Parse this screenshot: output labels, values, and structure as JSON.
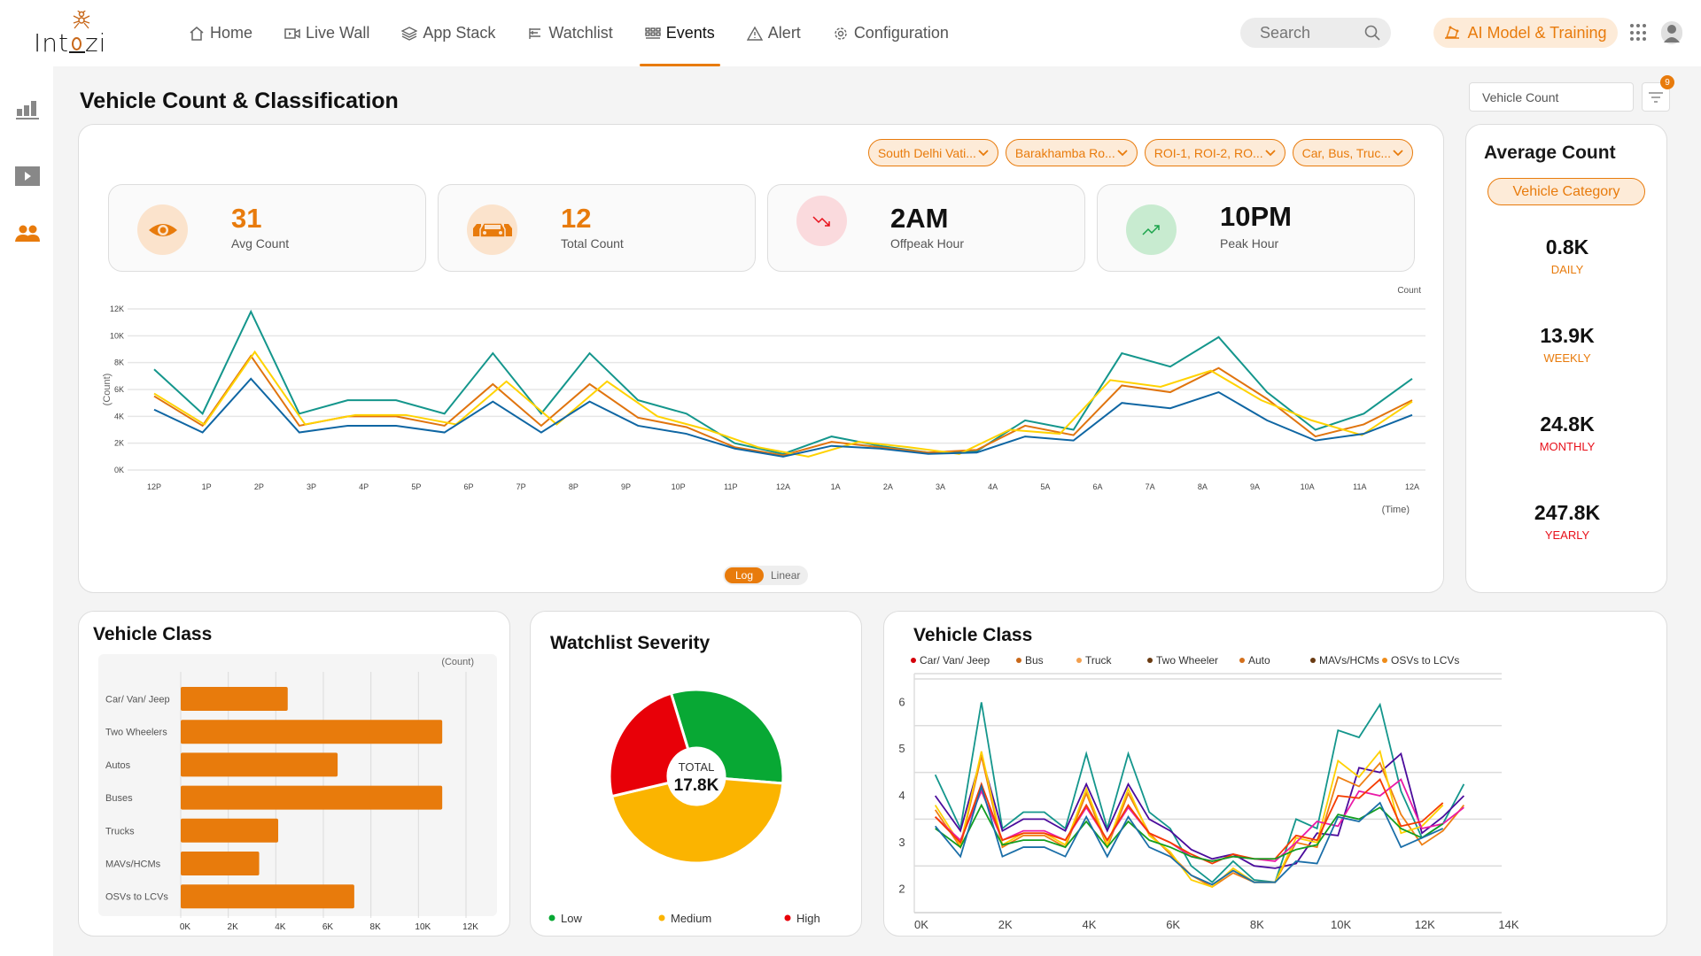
{
  "app": {
    "logo_text": "Int zi",
    "logo_prefix": "Int",
    "logo_suffix": "zi"
  },
  "nav": {
    "items": [
      {
        "label": "Home",
        "icon": "home-icon",
        "active": false
      },
      {
        "label": "Live Wall",
        "icon": "video-icon",
        "active": false
      },
      {
        "label": "App Stack",
        "icon": "layers-icon",
        "active": false
      },
      {
        "label": "Watchlist",
        "icon": "list-icon",
        "active": false
      },
      {
        "label": "Events",
        "icon": "grid-icon",
        "active": true
      },
      {
        "label": "Alert",
        "icon": "alert-icon",
        "active": false
      },
      {
        "label": "Configuration",
        "icon": "gear-icon",
        "active": false
      }
    ],
    "search_placeholder": "Search",
    "ai_button": "AI Model & Training"
  },
  "sidebar": {
    "items": [
      {
        "icon": "bar-chart-icon",
        "active": false
      },
      {
        "icon": "play-icon",
        "active": false
      },
      {
        "icon": "users-icon",
        "active": true
      }
    ]
  },
  "page": {
    "title": "Vehicle Count & Classification",
    "metric_select": "Vehicle Count",
    "filter_badge": "9"
  },
  "filters": [
    {
      "label": "South Delhi Vati..."
    },
    {
      "label": "Barakhamba Ro..."
    },
    {
      "label": "ROI-1, ROI-2, RO..."
    },
    {
      "label": "Car, Bus, Truc..."
    }
  ],
  "kpis": [
    {
      "value": "31",
      "label": "Avg Count",
      "icon": "eye-icon",
      "value_color": "#e87b0c",
      "bg": "#fbe3cc"
    },
    {
      "value": "12",
      "label": "Total Count",
      "icon": "cars-icon",
      "value_color": "#e87b0c",
      "bg": "#fbe3cc"
    },
    {
      "value": "2AM",
      "label": "Offpeak Hour",
      "icon": "trend-down-icon",
      "value_color": "#111111",
      "bg": "#fadadd"
    },
    {
      "value": "10PM",
      "label": "Peak Hour",
      "icon": "trend-up-icon",
      "value_color": "#111111",
      "bg": "#c8ebd0"
    }
  ],
  "scale_toggle": {
    "options": [
      "Log",
      "Linear"
    ],
    "selected": "Log"
  },
  "average_count": {
    "title": "Average Count",
    "category_button": "Vehicle Category",
    "items": [
      {
        "value": "0.8K",
        "label": "DAILY",
        "color": "#e87b0c"
      },
      {
        "value": "13.9K",
        "label": "WEEKLY",
        "color": "#e87b0c"
      },
      {
        "value": "24.8K",
        "label": "MONTHLY",
        "color": "#e8101a"
      },
      {
        "value": "247.8K",
        "label": "YEARLY",
        "color": "#e8101a"
      }
    ]
  },
  "chart_data": [
    {
      "id": "hourly-count",
      "type": "line",
      "title": "",
      "xlabel": "(Time)",
      "ylabel": "(Count)",
      "corner_label": "Count",
      "categories": [
        "12P",
        "1P",
        "2P",
        "3P",
        "4P",
        "5P",
        "6P",
        "7P",
        "8P",
        "9P",
        "10P",
        "11P",
        "12A",
        "1A",
        "2A",
        "3A",
        "4A",
        "5A",
        "6A",
        "7A",
        "8A",
        "9A",
        "10A",
        "11A",
        "12A"
      ],
      "yticks": [
        "0K",
        "2K",
        "4K",
        "6K",
        "8K",
        "10K",
        "12K"
      ],
      "ylim": [
        0,
        12000
      ],
      "grid": true,
      "series": [
        {
          "name": "series-teal",
          "color": "#14968c",
          "values": [
            7500,
            4200,
            11800,
            4200,
            5200,
            5200,
            4200,
            8700,
            4200,
            8700,
            5200,
            4200,
            2000,
            1200,
            2500,
            1800,
            1300,
            1400,
            3700,
            3000,
            8700,
            7700,
            9900,
            5800,
            3000,
            4200,
            6800
          ]
        },
        {
          "name": "series-orange",
          "color": "#e0740e",
          "values": [
            5500,
            3300,
            8500,
            3300,
            4000,
            4000,
            3300,
            6400,
            3300,
            6400,
            3900,
            3200,
            1700,
            1100,
            2100,
            1700,
            1300,
            1500,
            3300,
            2600,
            6300,
            5800,
            7600,
            5300,
            2500,
            3400,
            5200
          ]
        },
        {
          "name": "series-yellow",
          "color": "#ffd200",
          "values": [
            5700,
            3400,
            8800,
            3400,
            4100,
            4100,
            3400,
            6600,
            3400,
            6600,
            4000,
            3000,
            1700,
            1000,
            2100,
            1700,
            1200,
            3000,
            2700,
            6700,
            6200,
            7400,
            5200,
            3700,
            2600,
            5100
          ]
        },
        {
          "name": "series-blue",
          "color": "#0f66a3",
          "values": [
            4500,
            2800,
            6800,
            2800,
            3300,
            3300,
            2800,
            5100,
            2800,
            5100,
            3300,
            2700,
            1600,
            1000,
            1800,
            1600,
            1200,
            1300,
            2500,
            2200,
            5000,
            4600,
            5800,
            3700,
            2200,
            2700,
            4100
          ]
        }
      ]
    },
    {
      "id": "vehicle-class-bar",
      "type": "bar",
      "orientation": "horizontal",
      "title": "Vehicle Class",
      "xlabel": "(Count)",
      "categories": [
        "Car/ Van/ Jeep",
        "Two Wheelers",
        "Autos",
        "Buses",
        "Trucks",
        "MAVs/HCMs",
        "OSVs to LCVs"
      ],
      "values": [
        4500,
        11000,
        6600,
        11000,
        4100,
        3300,
        7300
      ],
      "xticks": [
        "0K",
        "2K",
        "4K",
        "6K",
        "8K",
        "10K",
        "12K"
      ],
      "xlim": [
        0,
        12000
      ],
      "color": "#e87b0c",
      "grid": true
    },
    {
      "id": "watchlist-severity",
      "type": "pie",
      "title": "Watchlist Severity",
      "center_label": "TOTAL",
      "center_value": "17.8K",
      "slices": [
        {
          "name": "Low",
          "value": 31,
          "color": "#08a834"
        },
        {
          "name": "Medium",
          "value": 45,
          "color": "#fbb400"
        },
        {
          "name": "High",
          "value": 24,
          "color": "#e80008"
        }
      ],
      "legend": "bottom"
    },
    {
      "id": "vehicle-class-lines",
      "type": "line",
      "title": "Vehicle Class",
      "legend": [
        {
          "name": "Car/ Van/ Jeep",
          "dot": "#d4000a"
        },
        {
          "name": "Bus",
          "dot": "#c8681a"
        },
        {
          "name": "Truck",
          "dot": "#f2a050"
        },
        {
          "name": "Two Wheeler",
          "dot": "#6a3b12"
        },
        {
          "name": "Auto",
          "dot": "#d4701c"
        },
        {
          "name": "MAVs/HCMs",
          "dot": "#6a3b12"
        },
        {
          "name": "OSVs to LCVs",
          "dot": "#ee8c1a"
        }
      ],
      "xticks": [
        "0K",
        "2K",
        "4K",
        "6K",
        "8K",
        "10K",
        "12K",
        "14K"
      ],
      "xlim": [
        0,
        14000
      ],
      "yticks": [
        "2",
        "3",
        "4",
        "5",
        "6"
      ],
      "ylim": [
        1.5,
        6.5
      ],
      "x": [
        500,
        1100,
        1600,
        2100,
        2600,
        3100,
        3600,
        4100,
        4600,
        5100,
        5600,
        6100,
        6600,
        7100,
        7600,
        8100,
        8600,
        9100,
        9600,
        10100,
        10600,
        11100,
        11600,
        12100,
        12600,
        13100
      ],
      "series": [
        {
          "name": "teal",
          "color": "#14968c",
          "values": [
            4.45,
            3.3,
            6.0,
            3.3,
            3.65,
            3.65,
            3.3,
            4.9,
            3.3,
            4.9,
            3.65,
            3.3,
            2.5,
            2.15,
            2.6,
            2.2,
            2.15,
            3.5,
            3.3,
            5.4,
            5.25,
            5.95,
            4.1,
            3.1,
            3.4,
            4.25
          ]
        },
        {
          "name": "purple",
          "color": "#4b0c9c",
          "values": [
            4.0,
            3.25,
            4.85,
            3.25,
            3.5,
            3.5,
            3.25,
            4.25,
            3.25,
            4.25,
            3.5,
            3.25,
            2.85,
            2.65,
            2.75,
            2.5,
            2.45,
            2.55,
            3.2,
            3.15,
            4.6,
            4.5,
            4.9,
            3.2,
            3.55,
            4.0
          ]
        },
        {
          "name": "orange",
          "color": "#ee7f13",
          "values": [
            3.7,
            2.9,
            4.85,
            2.9,
            3.15,
            3.15,
            2.9,
            4.05,
            2.9,
            4.05,
            3.2,
            2.75,
            2.3,
            2.05,
            2.35,
            2.15,
            2.15,
            3.0,
            2.9,
            4.4,
            4.2,
            4.7,
            3.6,
            2.95,
            3.25,
            3.8
          ]
        },
        {
          "name": "yellow",
          "color": "#ffd000",
          "values": [
            3.8,
            2.95,
            4.95,
            2.95,
            3.2,
            3.2,
            2.95,
            4.15,
            2.95,
            4.15,
            3.15,
            2.8,
            2.2,
            2.05,
            2.45,
            2.15,
            2.15,
            3.1,
            3.0,
            4.75,
            4.4,
            4.95,
            3.2,
            3.35,
            3.8
          ]
        },
        {
          "name": "magenta",
          "color": "#ea1aa7",
          "values": [
            3.55,
            3.05,
            4.1,
            3.05,
            3.25,
            3.25,
            3.05,
            3.75,
            3.05,
            3.75,
            3.2,
            3.0,
            2.7,
            2.6,
            2.7,
            2.65,
            2.6,
            3.0,
            3.45,
            3.35,
            4.1,
            4.0,
            4.35,
            3.3,
            3.4,
            3.75
          ]
        },
        {
          "name": "red",
          "color": "#f53c00",
          "values": [
            3.55,
            3.0,
            4.25,
            3.05,
            3.2,
            3.2,
            3.05,
            3.8,
            3.05,
            3.8,
            3.2,
            3.0,
            2.75,
            2.55,
            2.75,
            2.65,
            2.65,
            3.15,
            3.05,
            4.0,
            3.95,
            4.35,
            3.35,
            3.45,
            3.85
          ]
        },
        {
          "name": "green",
          "color": "#129e22",
          "values": [
            3.3,
            2.9,
            3.8,
            2.95,
            3.05,
            3.05,
            2.9,
            3.45,
            2.9,
            3.45,
            3.05,
            2.9,
            2.7,
            2.6,
            2.7,
            2.65,
            2.65,
            2.85,
            2.95,
            3.6,
            3.5,
            3.75,
            3.3,
            3.1,
            3.4
          ]
        },
        {
          "name": "blue",
          "color": "#1a6ea8",
          "values": [
            3.35,
            2.7,
            4.2,
            2.7,
            2.9,
            2.9,
            2.7,
            3.55,
            2.7,
            3.55,
            2.9,
            2.7,
            2.3,
            2.1,
            2.4,
            2.15,
            2.15,
            2.6,
            2.55,
            3.55,
            3.45,
            3.85,
            2.9,
            3.1,
            3.3
          ]
        }
      ]
    }
  ]
}
